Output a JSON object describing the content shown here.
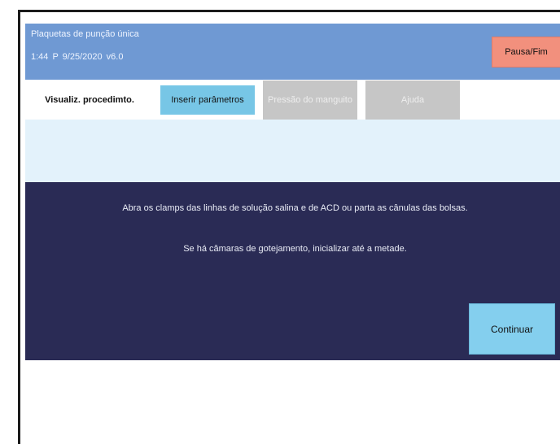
{
  "header": {
    "title": "Plaquetas de punção única",
    "status": "1:44 P  9/25/2020  v6.0",
    "pause_label": "Pausa/Fim"
  },
  "tabs": [
    {
      "label": "Visualiz. procedimto.",
      "state": "active"
    },
    {
      "label": "Inserir parâmetros",
      "state": "enabled"
    },
    {
      "label": "Pressão do manguito",
      "state": "disabled"
    },
    {
      "label": "Ajuda",
      "state": "disabled"
    }
  ],
  "panel": {
    "message_1": "Abra os clamps das linhas de solução salina e de ACD ou parta as cânulas das bolsas.",
    "message_2": "Se há câmaras de gotejamento, inicializar até a metade.",
    "continue_label": "Continuar"
  },
  "colors": {
    "header_bg": "#6f99d3",
    "pause_bg": "#f2907d",
    "tab_params_bg": "#77c6e6",
    "tab_disabled_bg": "#c6c6c6",
    "info_bar_bg": "#e3f2fb",
    "panel_bg": "#2a2b55",
    "continue_bg": "#84cfee"
  }
}
